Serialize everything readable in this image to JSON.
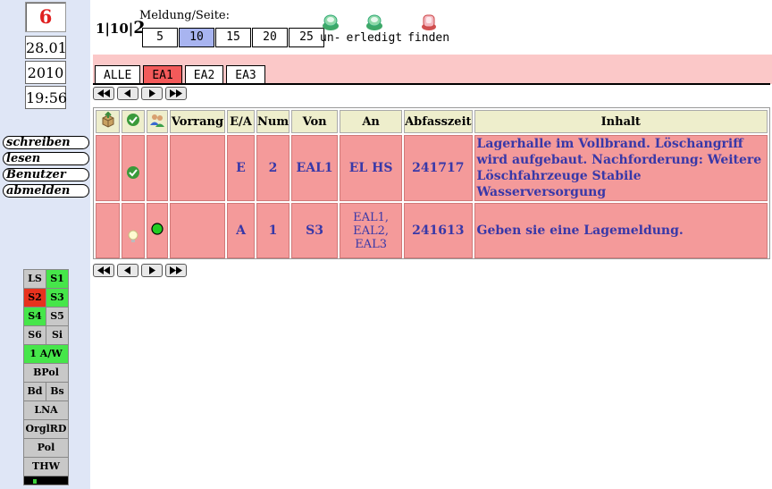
{
  "sidebar": {
    "counter": "6",
    "date": "28.01",
    "year": "2010",
    "time": "19:56",
    "links": [
      {
        "label": "schreiben"
      },
      {
        "label": "lesen"
      },
      {
        "label": "Benutzer"
      },
      {
        "label": "abmelden"
      }
    ],
    "status_rows": [
      [
        {
          "label": "LS",
          "color": "#c8c8c8"
        },
        {
          "label": "S1",
          "color": "#46e64a"
        }
      ],
      [
        {
          "label": "S2",
          "color": "#e8321e"
        },
        {
          "label": "S3",
          "color": "#46e64a"
        }
      ],
      [
        {
          "label": "S4",
          "color": "#46e64a"
        },
        {
          "label": "S5",
          "color": "#c8c8c8"
        }
      ],
      [
        {
          "label": "S6",
          "color": "#c8c8c8"
        },
        {
          "label": "Si",
          "color": "#c8c8c8"
        }
      ],
      [
        {
          "label": "1 A/W",
          "color": "#46e64a"
        }
      ],
      [
        {
          "label": "BPol",
          "color": "#c8c8c8"
        }
      ],
      [
        {
          "label": "Bd",
          "color": "#c8c8c8"
        },
        {
          "label": "Bs",
          "color": "#c8c8c8"
        }
      ],
      [
        {
          "label": "LNA",
          "color": "#c8c8c8"
        }
      ],
      [
        {
          "label": "OrglRD",
          "color": "#c8c8c8"
        }
      ],
      [
        {
          "label": "Pol",
          "color": "#c8c8c8"
        }
      ],
      [
        {
          "label": "THW",
          "color": "#c8c8c8"
        }
      ]
    ]
  },
  "paging": {
    "current": "1",
    "per_page": "10",
    "total": "2",
    "label": "Meldung/Seite:",
    "options": [
      "5",
      "10",
      "15",
      "20",
      "25"
    ],
    "selected": "10"
  },
  "tools": [
    {
      "label": "un-",
      "icon": "unread-icon"
    },
    {
      "label": "erledigt",
      "icon": "done-icon"
    },
    {
      "label": "finden",
      "icon": "find-icon"
    }
  ],
  "tabs": [
    {
      "label": "ALLE",
      "active": false
    },
    {
      "label": "EA1",
      "active": true
    },
    {
      "label": "EA2",
      "active": false
    },
    {
      "label": "EA3",
      "active": false
    }
  ],
  "table": {
    "headers": [
      "",
      "",
      "",
      "Vorrang",
      "E/A",
      "Num",
      "Von",
      "An",
      "Abfasszeit",
      "Inhalt"
    ],
    "rows": [
      {
        "icon2": "check-icon",
        "icon3": "",
        "vorrang": "",
        "ea": "E",
        "num": "2",
        "von": "EAL1",
        "an": "EL HS",
        "abfasszeit": "241717",
        "inhalt": "Lagerhalle im Vollbrand. Löschangriff wird aufgebaut. Nachforderung: Weitere Löschfahrzeuge Stabile Wasserversorgung"
      },
      {
        "icon2": "bulb-icon",
        "icon3": "green-dot-icon",
        "vorrang": "",
        "ea": "A",
        "num": "1",
        "von": "S3",
        "an": "EAL1, EAL2, EAL3",
        "abfasszeit": "241613",
        "inhalt": "Geben sie eine Lagemeldung."
      }
    ]
  }
}
